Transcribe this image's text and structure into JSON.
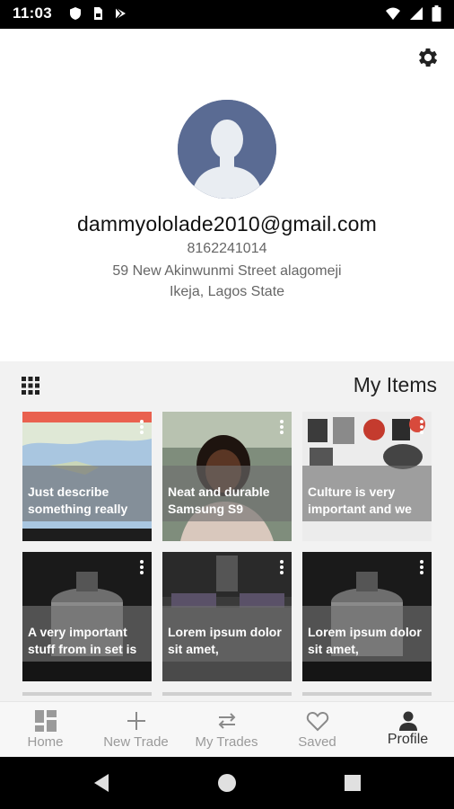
{
  "status_bar": {
    "time": "11:03",
    "left_icons": [
      "shield-icon",
      "sim-card-icon",
      "play-store-icon"
    ],
    "right_icons": [
      "wifi-icon",
      "cellular-signal-icon",
      "battery-icon"
    ]
  },
  "profile": {
    "email": "dammyololade2010@gmail.com",
    "phone": "8162241014",
    "address_line1": "59 New Akinwunmi Street alagomeji",
    "address_line2": "Ikeja, Lagos State",
    "avatar_color": "#5a6b93"
  },
  "items_section": {
    "title": "My Items",
    "items": [
      {
        "caption": "Just describe something really",
        "image": "map-screenshot"
      },
      {
        "caption": "Neat and durable Samsung S9",
        "image": "woman-selfie"
      },
      {
        "caption": "Culture is very important and we",
        "image": "kitchen-appliances"
      },
      {
        "caption": "A very important stuff from in set is that things like ...",
        "image": "pressure-cooker"
      },
      {
        "caption": "Lorem ipsum dolor sit amet,",
        "image": "living-room"
      },
      {
        "caption": "Lorem ipsum dolor sit amet, consectetur ...",
        "image": "pressure-cooker"
      }
    ]
  },
  "tabs": [
    {
      "label": "Home",
      "icon": "dashboard-icon",
      "active": false
    },
    {
      "label": "New Trade",
      "icon": "plus-icon",
      "active": false
    },
    {
      "label": "My Trades",
      "icon": "swap-arrows-icon",
      "active": false
    },
    {
      "label": "Saved",
      "icon": "heart-icon",
      "active": false
    },
    {
      "label": "Profile",
      "icon": "person-icon",
      "active": true
    }
  ],
  "nav_bar": {
    "buttons": [
      "back-icon",
      "home-circle-icon",
      "recents-square-icon"
    ]
  }
}
